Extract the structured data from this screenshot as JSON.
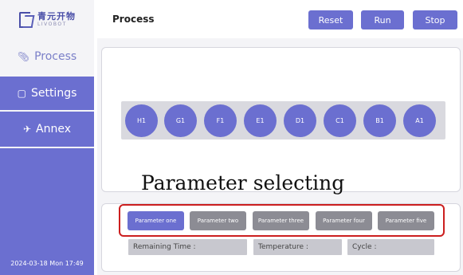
{
  "logo": {
    "cn": "青元开物",
    "en": "LIVOBOT"
  },
  "sidebar": {
    "items": [
      {
        "label": "Process",
        "icon": "paperclip-icon"
      },
      {
        "label": "Settings",
        "icon": "settings-icon"
      },
      {
        "label": "Annex",
        "icon": "plane-icon"
      }
    ],
    "datetime": "2024-03-18 Mon 17:49"
  },
  "header": {
    "title": "Process",
    "buttons": {
      "reset": "Reset",
      "run": "Run",
      "stop": "Stop"
    }
  },
  "wells": [
    "H1",
    "G1",
    "F1",
    "E1",
    "D1",
    "C1",
    "B1",
    "A1"
  ],
  "annotation": "Parameter selecting",
  "parameters": {
    "items": [
      "Parameter one",
      "Parameter two",
      "Parameter three",
      "Parameter four",
      "Parameter five"
    ],
    "selected": "Parameter one"
  },
  "status": {
    "remaining_time": "Remaining Time :",
    "temperature": "Temperature :",
    "cycle": "Cycle :"
  },
  "colors": {
    "accent": "#6b6fd0",
    "inactive_button": "#8c8c94",
    "highlight": "#cc1f1f"
  }
}
